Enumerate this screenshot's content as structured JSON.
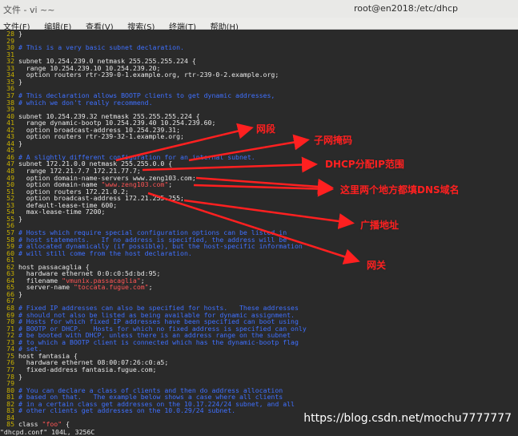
{
  "window": {
    "title": "root@en2018:/etc/dhcp",
    "left_title": "文件 - vi ~~"
  },
  "menu": [
    "文件(F)",
    "编辑(E)",
    "查看(V)",
    "搜索(S)",
    "终端(T)",
    "帮助(H)"
  ],
  "lines": [
    {
      "n": "28",
      "parts": [
        {
          "t": "}",
          "c": "code"
        }
      ]
    },
    {
      "n": "29",
      "parts": []
    },
    {
      "n": "30",
      "parts": [
        {
          "t": "# This is a very basic subnet declaration.",
          "c": "cmt"
        }
      ]
    },
    {
      "n": "31",
      "parts": []
    },
    {
      "n": "32",
      "parts": [
        {
          "t": "subnet 10.254.239.0 netmask 255.255.255.224 {",
          "c": "code"
        }
      ]
    },
    {
      "n": "33",
      "parts": [
        {
          "t": "  range 10.254.239.10 10.254.239.20;",
          "c": "code"
        }
      ]
    },
    {
      "n": "34",
      "parts": [
        {
          "t": "  option routers rtr-239-0-1.example.org, rtr-239-0-2.example.org;",
          "c": "code"
        }
      ]
    },
    {
      "n": "35",
      "parts": [
        {
          "t": "}",
          "c": "code"
        }
      ]
    },
    {
      "n": "36",
      "parts": []
    },
    {
      "n": "37",
      "parts": [
        {
          "t": "# This declaration allows BOOTP clients to get dynamic addresses,",
          "c": "cmt"
        }
      ]
    },
    {
      "n": "38",
      "parts": [
        {
          "t": "# which we don't really recommend.",
          "c": "cmt"
        }
      ]
    },
    {
      "n": "39",
      "parts": []
    },
    {
      "n": "40",
      "parts": [
        {
          "t": "subnet 10.254.239.32 netmask 255.255.255.224 {",
          "c": "code"
        }
      ]
    },
    {
      "n": "41",
      "parts": [
        {
          "t": "  range dynamic-bootp 10.254.239.40 10.254.239.60;",
          "c": "code"
        }
      ]
    },
    {
      "n": "42",
      "parts": [
        {
          "t": "  option broadcast-address 10.254.239.31;",
          "c": "code"
        }
      ]
    },
    {
      "n": "43",
      "parts": [
        {
          "t": "  option routers rtr-239-32-1.example.org;",
          "c": "code"
        }
      ]
    },
    {
      "n": "44",
      "parts": [
        {
          "t": "}",
          "c": "code"
        }
      ]
    },
    {
      "n": "45",
      "parts": []
    },
    {
      "n": "46",
      "parts": [
        {
          "t": "# A slightly different configuration for an internal subnet.",
          "c": "cmt"
        }
      ]
    },
    {
      "n": "47",
      "parts": [
        {
          "t": "subnet 172.21.0.0 netmask 255.255.0.0 {",
          "c": "code"
        }
      ]
    },
    {
      "n": "48",
      "parts": [
        {
          "t": "  range 172.21.7.7 172.21.77.7;",
          "c": "code"
        }
      ]
    },
    {
      "n": "49",
      "parts": [
        {
          "t": "  option domain-name-servers www.zeng103.com;",
          "c": "code"
        }
      ]
    },
    {
      "n": "50",
      "parts": [
        {
          "t": "  option domain-name ",
          "c": "code"
        },
        {
          "t": "\"www.zeng103.com\"",
          "c": "str"
        },
        {
          "t": ";",
          "c": "code"
        }
      ]
    },
    {
      "n": "51",
      "parts": [
        {
          "t": "  option routers 172.21.0.2;",
          "c": "code"
        }
      ]
    },
    {
      "n": "52",
      "parts": [
        {
          "t": "  option broadcast-address 172.21.255.255;",
          "c": "code"
        }
      ]
    },
    {
      "n": "53",
      "parts": [
        {
          "t": "  default-lease-time 600;",
          "c": "code"
        }
      ]
    },
    {
      "n": "54",
      "parts": [
        {
          "t": "  max-lease-time 7200;",
          "c": "code"
        }
      ]
    },
    {
      "n": "55",
      "parts": [
        {
          "t": "}",
          "c": "code"
        }
      ]
    },
    {
      "n": "56",
      "parts": []
    },
    {
      "n": "57",
      "parts": [
        {
          "t": "# Hosts which require special configuration options can be listed in",
          "c": "cmt"
        }
      ]
    },
    {
      "n": "58",
      "parts": [
        {
          "t": "# host statements.   If no address is specified, the address will be",
          "c": "cmt"
        }
      ]
    },
    {
      "n": "59",
      "parts": [
        {
          "t": "# allocated dynamically (if possible), but the host-specific information",
          "c": "cmt"
        }
      ]
    },
    {
      "n": "60",
      "parts": [
        {
          "t": "# will still come from the host declaration.",
          "c": "cmt"
        }
      ]
    },
    {
      "n": "61",
      "parts": []
    },
    {
      "n": "62",
      "parts": [
        {
          "t": "host passacaglia {",
          "c": "code"
        }
      ]
    },
    {
      "n": "63",
      "parts": [
        {
          "t": "  hardware ethernet 0:0:c0:5d:bd:95;",
          "c": "code"
        }
      ]
    },
    {
      "n": "64",
      "parts": [
        {
          "t": "  filename ",
          "c": "code"
        },
        {
          "t": "\"vmunix.passacaglia\"",
          "c": "str"
        },
        {
          "t": ";",
          "c": "code"
        }
      ]
    },
    {
      "n": "65",
      "parts": [
        {
          "t": "  server-name ",
          "c": "code"
        },
        {
          "t": "\"toccata.fugue.com\"",
          "c": "str"
        },
        {
          "t": ";",
          "c": "code"
        }
      ]
    },
    {
      "n": "66",
      "parts": [
        {
          "t": "}",
          "c": "code"
        }
      ]
    },
    {
      "n": "67",
      "parts": []
    },
    {
      "n": "68",
      "parts": [
        {
          "t": "# Fixed IP addresses can also be specified for hosts.   These addresses",
          "c": "cmt"
        }
      ]
    },
    {
      "n": "69",
      "parts": [
        {
          "t": "# should not also be listed as being available for dynamic assignment.",
          "c": "cmt"
        }
      ]
    },
    {
      "n": "70",
      "parts": [
        {
          "t": "# Hosts for which fixed IP addresses have been specified can boot using",
          "c": "cmt"
        }
      ]
    },
    {
      "n": "71",
      "parts": [
        {
          "t": "# BOOTP or DHCP.   Hosts for which no fixed address is specified can only",
          "c": "cmt"
        }
      ]
    },
    {
      "n": "72",
      "parts": [
        {
          "t": "# be booted with DHCP, unless there is an address range on the subnet",
          "c": "cmt"
        }
      ]
    },
    {
      "n": "73",
      "parts": [
        {
          "t": "# to which a BOOTP client is connected which has the dynamic-bootp flag",
          "c": "cmt"
        }
      ]
    },
    {
      "n": "74",
      "parts": [
        {
          "t": "# set.",
          "c": "cmt"
        }
      ]
    },
    {
      "n": "75",
      "parts": [
        {
          "t": "host fantasia {",
          "c": "code"
        }
      ]
    },
    {
      "n": "76",
      "parts": [
        {
          "t": "  hardware ethernet 08:00:07:26:c0:a5;",
          "c": "code"
        }
      ]
    },
    {
      "n": "77",
      "parts": [
        {
          "t": "  fixed-address fantasia.fugue.com;",
          "c": "code"
        }
      ]
    },
    {
      "n": "78",
      "parts": [
        {
          "t": "}",
          "c": "code"
        }
      ]
    },
    {
      "n": "79",
      "parts": []
    },
    {
      "n": "80",
      "parts": [
        {
          "t": "# You can declare a class of clients and then do address allocation",
          "c": "cmt"
        }
      ]
    },
    {
      "n": "81",
      "parts": [
        {
          "t": "# based on that.   The example below shows a case where all clients",
          "c": "cmt"
        }
      ]
    },
    {
      "n": "82",
      "parts": [
        {
          "t": "# in a certain class get addresses on the 10.17.224/24 subnet, and all",
          "c": "cmt"
        }
      ]
    },
    {
      "n": "83",
      "parts": [
        {
          "t": "# other clients get addresses on the 10.0.29/24 subnet.",
          "c": "cmt"
        }
      ]
    },
    {
      "n": "84",
      "parts": []
    },
    {
      "n": "85",
      "parts": [
        {
          "t": "class ",
          "c": "code"
        },
        {
          "t": "\"foo\"",
          "c": "str"
        },
        {
          "t": " {",
          "c": "code"
        }
      ]
    }
  ],
  "status": "\"dhcpd.conf\" 104L, 3256C",
  "annotations": [
    {
      "id": "wangduan",
      "text": "网段"
    },
    {
      "id": "ziwang",
      "text": "子网掩码"
    },
    {
      "id": "dhcp",
      "text": "DHCP分配IP范围"
    },
    {
      "id": "dns",
      "text": "这里两个地方都填DNS域名"
    },
    {
      "id": "broadcast",
      "text": "广播地址"
    },
    {
      "id": "gateway",
      "text": "网关"
    }
  ],
  "watermark": "https://blog.csdn.net/mochu7777777",
  "colors": {
    "comment": "#3f70ff",
    "string": "#ff5555",
    "linenum": "#c8b000",
    "annotation": "#ff2020"
  }
}
